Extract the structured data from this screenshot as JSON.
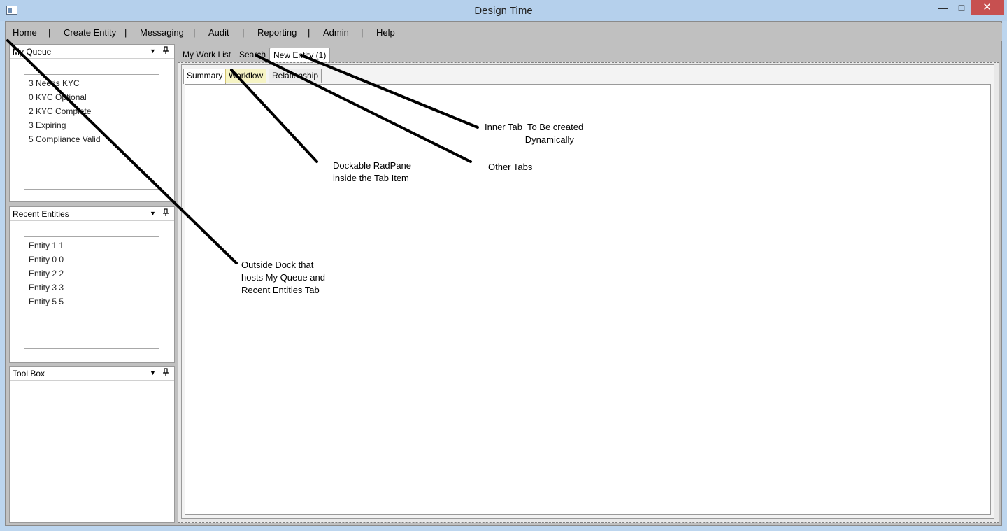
{
  "window": {
    "title": "Design Time",
    "minimize_glyph": "—",
    "maximize_glyph": "□",
    "close_glyph": "✕"
  },
  "menu": {
    "items": [
      "Home",
      "Create Entity",
      "Messaging",
      "Audit",
      "Reporting",
      "Admin",
      "Help"
    ],
    "separator": "|"
  },
  "panes": {
    "my_queue": {
      "title": "My Queue",
      "items": [
        "3 Needs KYC",
        "0 KYC Optional",
        "2 KYC Complete",
        "3 Expiring",
        "5 Compliance Valid"
      ]
    },
    "recent_entities": {
      "title": "Recent Entities",
      "items": [
        "Entity 1 1",
        "Entity 0 0",
        "Entity 2 2",
        "Entity 3 3",
        "Entity 5 5"
      ]
    },
    "tool_box": {
      "title": "Tool Box"
    },
    "dropdown_glyph": "▼"
  },
  "doc_tabs": [
    "My Work List",
    "Search",
    "New Entity (1)"
  ],
  "inner_tabs": [
    "Summary",
    "Workflow",
    "Relationship"
  ],
  "annotations": {
    "inner_tab": "Inner Tab  To Be created\n                Dynamically",
    "other_tabs": "Other Tabs",
    "dockable": "Dockable RadPane\ninside the Tab Item",
    "outside_dock": "Outside Dock that\nhosts My Queue and\nRecent Entities Tab"
  },
  "colors": {
    "titlebar": "#b5d0ec",
    "close_button": "#c75050",
    "hover_tab": "#f6f4c4"
  }
}
